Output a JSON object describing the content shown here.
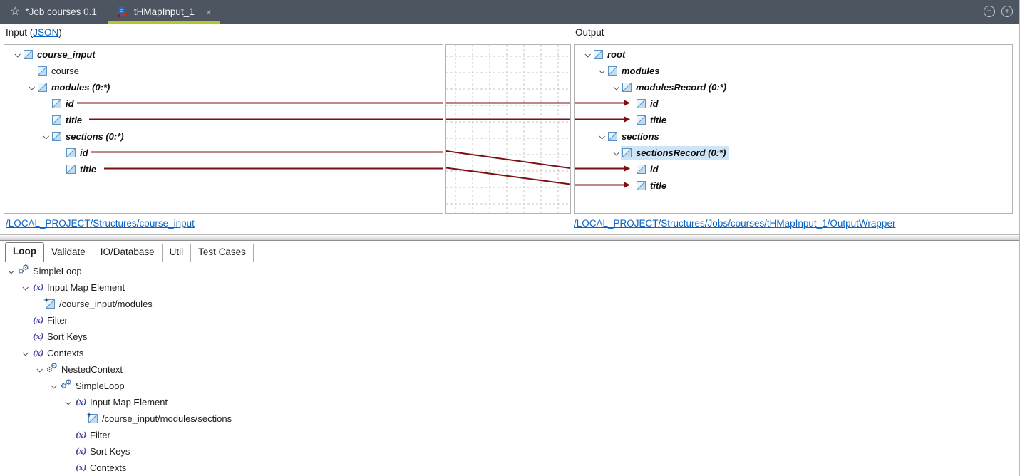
{
  "window": {
    "tabs": [
      {
        "label": "*Job courses 0.1"
      },
      {
        "label": "tHMapInput_1"
      }
    ]
  },
  "icons": {
    "job_star_glyph": "☆",
    "close_glyph": "×",
    "minimize_glyph": "−",
    "maximize_glyph": "+",
    "gear_glyph": "⚙",
    "fx_glyph": "(x)"
  },
  "mapper": {
    "input_header": {
      "prefix": "Input (",
      "link": "JSON",
      "suffix": ")"
    },
    "output_header": "Output",
    "input_tree": [
      {
        "depth": 0,
        "label": "course_input",
        "chevron": true,
        "emph": true
      },
      {
        "depth": 1,
        "label": "course",
        "chevron": false,
        "emph": false
      },
      {
        "depth": 1,
        "label": "modules (0:*)",
        "chevron": true,
        "emph": true
      },
      {
        "depth": 2,
        "label": "id",
        "chevron": false,
        "emph": true
      },
      {
        "depth": 2,
        "label": "title",
        "chevron": false,
        "emph": true
      },
      {
        "depth": 2,
        "label": "sections (0:*)",
        "chevron": true,
        "emph": true
      },
      {
        "depth": 3,
        "label": "id",
        "chevron": false,
        "emph": true
      },
      {
        "depth": 3,
        "label": "title",
        "chevron": false,
        "emph": true
      }
    ],
    "output_tree": [
      {
        "depth": 0,
        "label": "root",
        "chevron": true,
        "emph": true
      },
      {
        "depth": 1,
        "label": "modules",
        "chevron": true,
        "emph": true
      },
      {
        "depth": 2,
        "label": "modulesRecord (0:*)",
        "chevron": true,
        "emph": true
      },
      {
        "depth": 3,
        "label": "id",
        "chevron": false,
        "emph": true
      },
      {
        "depth": 3,
        "label": "title",
        "chevron": false,
        "emph": true
      },
      {
        "depth": 1,
        "label": "sections",
        "chevron": true,
        "emph": true
      },
      {
        "depth": 2,
        "label": "sectionsRecord (0:*)",
        "chevron": true,
        "emph": true,
        "selected": true
      },
      {
        "depth": 3,
        "label": "id",
        "chevron": false,
        "emph": true
      },
      {
        "depth": 3,
        "label": "title",
        "chevron": false,
        "emph": true
      }
    ],
    "mappings": [
      {
        "from": "/course_input/modules/id",
        "to": "/root/modules/modulesRecord/id"
      },
      {
        "from": "/course_input/modules/title",
        "to": "/root/modules/modulesRecord/title"
      },
      {
        "from": "/course_input/modules/sections/id",
        "to": "/root/sections/sectionsRecord/id"
      },
      {
        "from": "/course_input/modules/sections/title",
        "to": "/root/sections/sectionsRecord/title"
      }
    ],
    "input_link": "/LOCAL_PROJECT/Structures/course_input",
    "output_link": "/LOCAL_PROJECT/Structures/Jobs/courses/tHMapInput_1/OutputWrapper"
  },
  "properties": {
    "tabs": [
      {
        "label": "Loop",
        "active": true
      },
      {
        "label": "Validate"
      },
      {
        "label": "IO/Database"
      },
      {
        "label": "Util"
      },
      {
        "label": "Test Cases"
      }
    ],
    "tree": [
      {
        "depth": 0,
        "label": "SimpleLoop",
        "icon": "loop",
        "chevron": true
      },
      {
        "depth": 1,
        "label": "Input Map Element",
        "icon": "fx",
        "chevron": true
      },
      {
        "depth": 2,
        "label": "/course_input/modules",
        "icon": "element-new",
        "chevron": false
      },
      {
        "depth": 1,
        "label": "Filter",
        "icon": "fx",
        "chevron": false
      },
      {
        "depth": 1,
        "label": "Sort Keys",
        "icon": "fx",
        "chevron": false
      },
      {
        "depth": 1,
        "label": "Contexts",
        "icon": "fx",
        "chevron": true
      },
      {
        "depth": 2,
        "label": "NestedContext",
        "icon": "loop",
        "chevron": true
      },
      {
        "depth": 3,
        "label": "SimpleLoop",
        "icon": "loop",
        "chevron": true
      },
      {
        "depth": 4,
        "label": "Input Map Element",
        "icon": "fx",
        "chevron": true
      },
      {
        "depth": 5,
        "label": "/course_input/modules/sections",
        "icon": "element-new",
        "chevron": false
      },
      {
        "depth": 4,
        "label": "Filter",
        "icon": "fx",
        "chevron": false
      },
      {
        "depth": 4,
        "label": "Sort Keys",
        "icon": "fx",
        "chevron": false
      },
      {
        "depth": 4,
        "label": "Contexts",
        "icon": "fx",
        "chevron": false
      }
    ]
  },
  "colors": {
    "topbar_bg": "#4d5561",
    "active_tab_underline": "#b2c72c",
    "mapping_line": "#7c1114",
    "link_blue": "#0b63c5",
    "selection_bg": "#cfe5f7"
  }
}
